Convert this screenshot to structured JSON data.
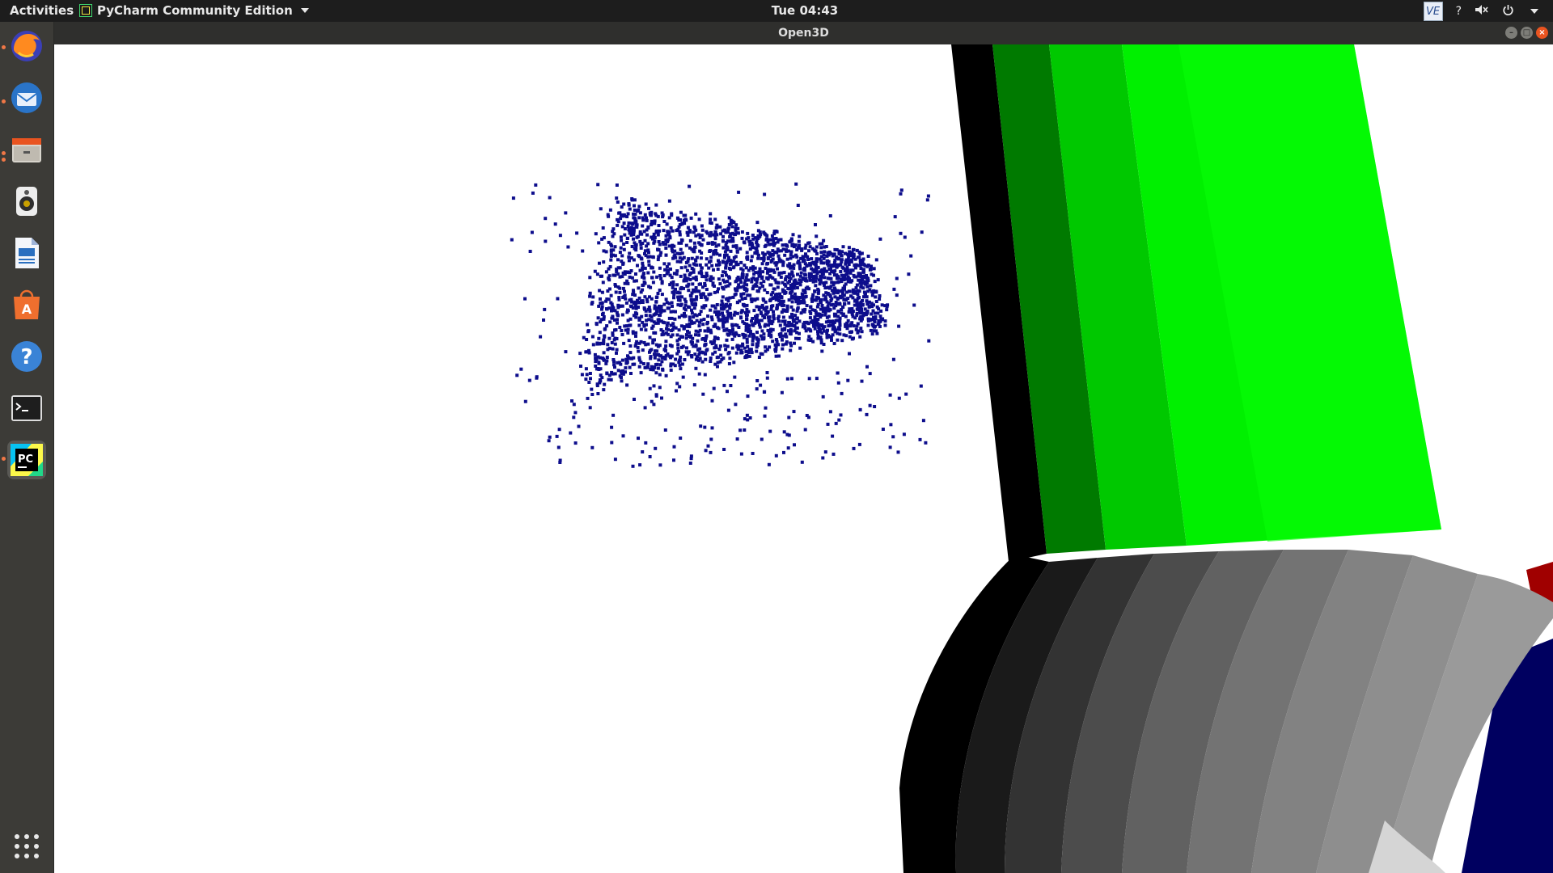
{
  "topbar": {
    "activities": "Activities",
    "app_menu": "PyCharm Community Edition",
    "clock": "Tue 04:43",
    "tray_ve": "VE",
    "tray_help": "?"
  },
  "dock": {
    "items": [
      {
        "name": "firefox",
        "running": true
      },
      {
        "name": "thunderbird",
        "running": true
      },
      {
        "name": "files",
        "running": true
      },
      {
        "name": "rhythmbox",
        "running": false
      },
      {
        "name": "writer",
        "running": false
      },
      {
        "name": "software",
        "running": false
      },
      {
        "name": "help",
        "running": false
      },
      {
        "name": "terminal",
        "running": false
      },
      {
        "name": "pycharm",
        "running": true
      }
    ]
  },
  "window": {
    "title": "Open3D"
  },
  "colors": {
    "pointcloud": "#0d0d8c",
    "green_bright": "#00f000",
    "green_mid": "#00d000",
    "green_dark": "#00a800",
    "torus_gray": "#8a8a8a",
    "red_axis": "#a00000",
    "blue_axis": "#000060"
  }
}
